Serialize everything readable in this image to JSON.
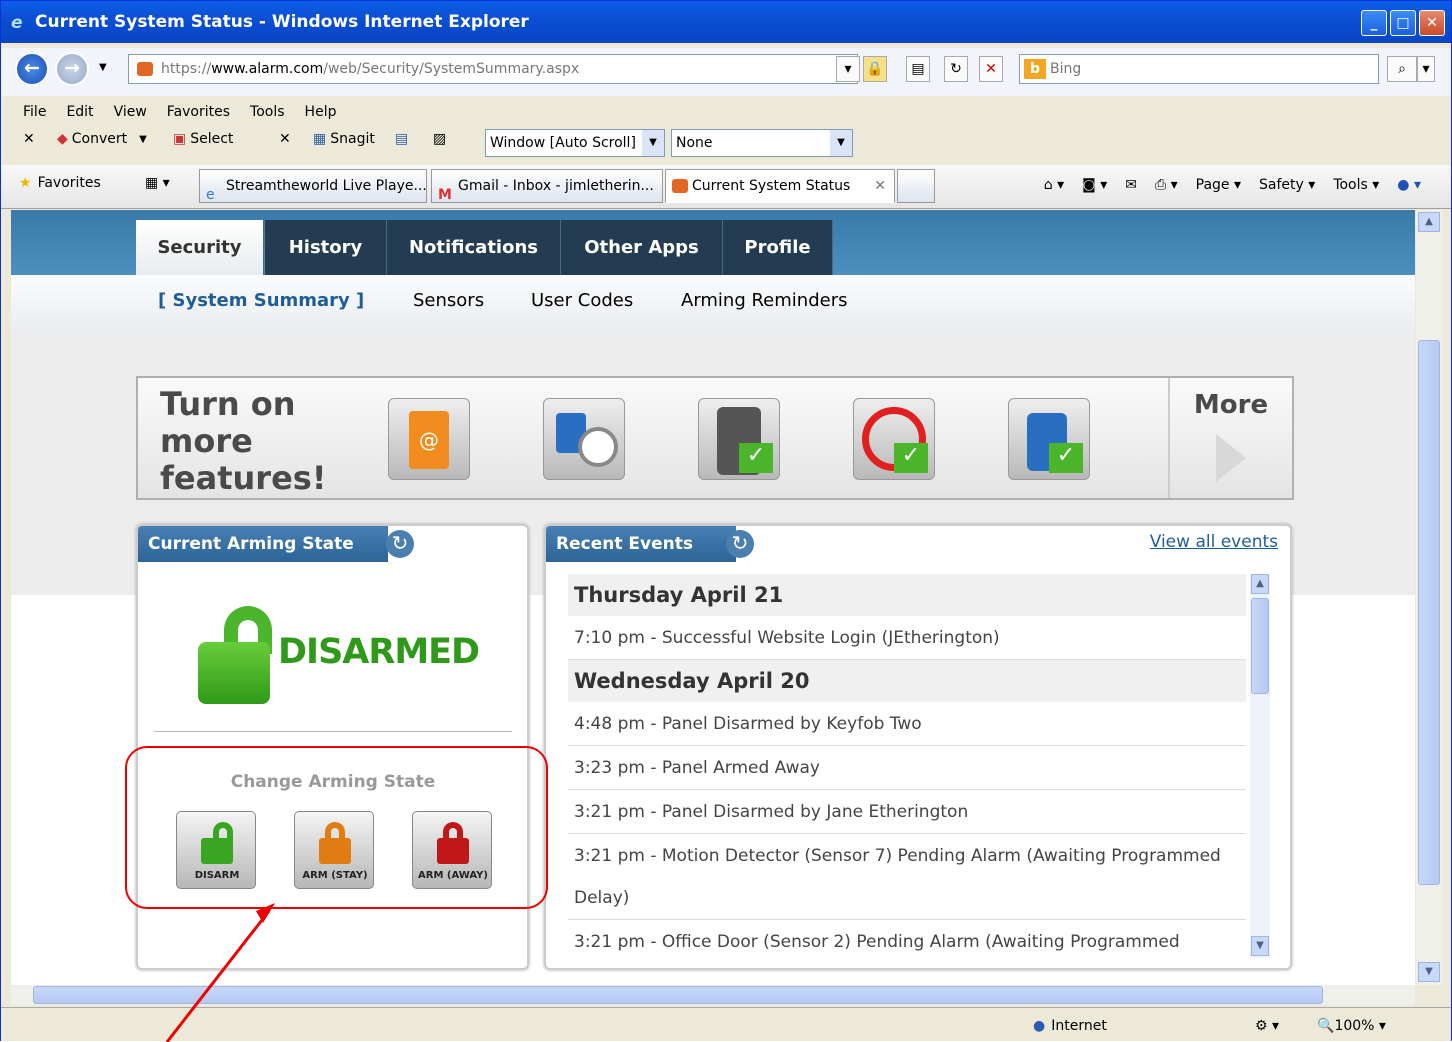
{
  "window": {
    "title": "Current System Status - Windows Internet Explorer"
  },
  "address": {
    "url_prefix": "https://",
    "url_host": "www.alarm.com",
    "url_path": "/web/Security/SystemSummary.aspx",
    "search_placeholder": "Bing"
  },
  "menu": [
    "File",
    "Edit",
    "View",
    "Favorites",
    "Tools",
    "Help"
  ],
  "cmdbar": {
    "convert": "Convert",
    "select": "Select",
    "snagit": "Snagit",
    "dropdown1": "Window [Auto Scroll]",
    "dropdown2": "None"
  },
  "favbar": {
    "favorites": "Favorites",
    "tabs": [
      "Streamtheworld Live Playe...",
      "Gmail - Inbox - jimletherin...",
      "Current System Status"
    ],
    "tools": [
      "Page",
      "Safety",
      "Tools"
    ]
  },
  "nav": {
    "tabs": [
      "Security",
      "History",
      "Notifications",
      "Other Apps",
      "Profile"
    ],
    "sub": [
      "[ System Summary ]",
      "Sensors",
      "User Codes",
      "Arming Reminders"
    ]
  },
  "promo": {
    "title": "Turn on more features!",
    "more": "More"
  },
  "arming": {
    "title": "Current Arming State",
    "state": "DISARMED",
    "change_label": "Change Arming State",
    "buttons": [
      "DISARM",
      "ARM (STAY)",
      "ARM (AWAY)"
    ]
  },
  "events": {
    "title": "Recent Events",
    "view_all": "View all events",
    "days": [
      {
        "day": "Thursday April 21",
        "items": [
          "7:10 pm - Successful Website Login (JEtherington)"
        ]
      },
      {
        "day": "Wednesday April 20",
        "items": [
          "4:48 pm - Panel Disarmed by Keyfob Two",
          "3:23 pm - Panel Armed Away",
          "3:21 pm - Panel Disarmed by Jane Etherington",
          "3:21 pm - Motion Detector (Sensor 7) Pending Alarm (Awaiting Programmed",
          "Delay)",
          "3:21 pm - Office Door (Sensor 2) Pending Alarm (Awaiting Programmed"
        ]
      }
    ]
  },
  "status": {
    "zone": "Internet",
    "zoom": "100%"
  },
  "colors": {
    "accent": "#233c52",
    "green": "#2f9a19",
    "annotation": "#e00000"
  }
}
